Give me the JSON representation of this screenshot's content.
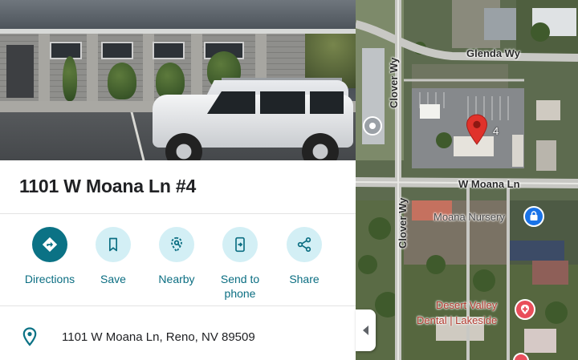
{
  "place": {
    "title": "1101 W Moana Ln #4",
    "address": "1101 W Moana Ln, Reno, NV 89509"
  },
  "actions": [
    {
      "label": "Directions",
      "icon": "directions-icon"
    },
    {
      "label": "Save",
      "icon": "bookmark-icon"
    },
    {
      "label": "Nearby",
      "icon": "nearby-icon"
    },
    {
      "label": "Send to\nphone",
      "icon": "send-to-phone-icon"
    },
    {
      "label": "Share",
      "icon": "share-icon"
    }
  ],
  "map": {
    "roads": [
      "Glenda Wy",
      "Clover Wy",
      "W Moana Ln",
      "Clover Wy"
    ],
    "pin_label": "4",
    "places": [
      {
        "name": "Moana Nursery",
        "icon": "shopping-bag-icon"
      },
      {
        "name": "Desert Valley\nDental | Lakeside",
        "icon": "medical-icon"
      }
    ]
  },
  "colors": {
    "accent": "#0b7285",
    "accent_light": "#d3eff5",
    "pin": "#e0322b"
  }
}
